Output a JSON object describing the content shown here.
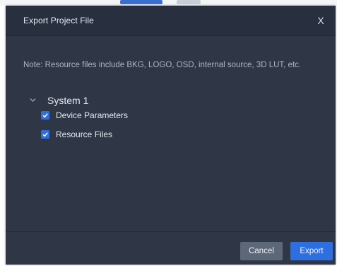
{
  "dialog": {
    "title": "Export Project File",
    "close_label": "X",
    "note": "Note: Resource files include BKG, LOGO, OSD, internal source, 3D LUT, etc.",
    "tree": {
      "node_label": "System 1",
      "expanded": true,
      "children": [
        {
          "label": "Device Parameters",
          "checked": true
        },
        {
          "label": "Resource Files",
          "checked": true
        }
      ]
    },
    "buttons": {
      "cancel_label": "Cancel",
      "export_label": "Export"
    }
  },
  "colors": {
    "dialog_bg": "#2f3747",
    "header_bg": "#283040",
    "accent": "#2d6fe0",
    "cancel_bg": "#5c6778"
  },
  "icons": {
    "close": "close-icon",
    "expand": "chevron-down-icon",
    "check": "checkmark-icon"
  }
}
